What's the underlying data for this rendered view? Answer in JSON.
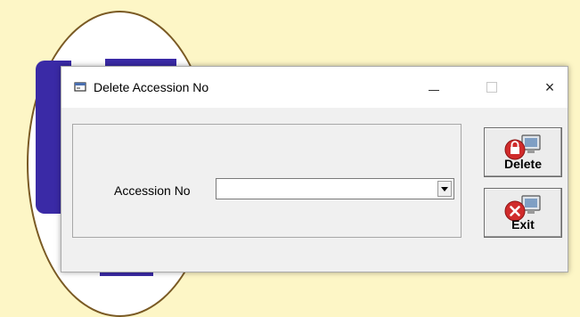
{
  "window": {
    "title": "Delete Accession No",
    "close_glyph": "×"
  },
  "form": {
    "accession_label": "Accession No",
    "accession_value": ""
  },
  "buttons": {
    "delete_label": "Delete",
    "exit_label": "Exit"
  },
  "icons": {
    "window": "app-window-icon",
    "delete": "delete-lock-computer-icon",
    "exit": "exit-x-computer-icon",
    "dropdown": "chevron-down-icon"
  },
  "colors": {
    "desktop_bg": "#fdf6c6",
    "bg_app_accent": "#3a2aa6",
    "window_bg": "#f0f0f0",
    "icon_red": "#d02b2b"
  }
}
